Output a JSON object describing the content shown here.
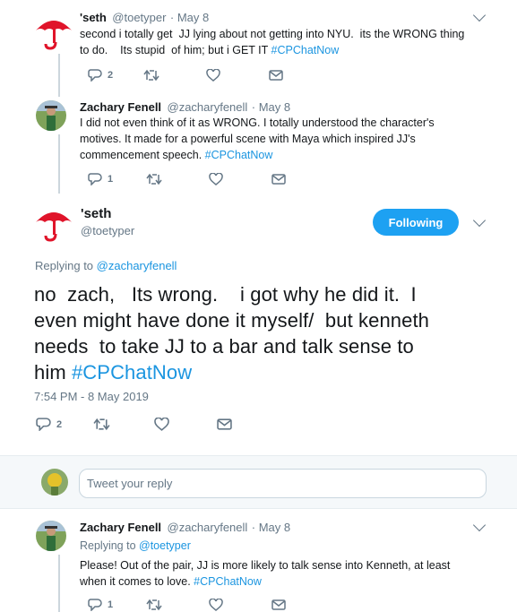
{
  "colors": {
    "accent": "#1da1f2",
    "link": "#1b95e0",
    "umbrella": "#e0142a"
  },
  "tweet1": {
    "name": "'seth",
    "handle": "@toetyper",
    "time": "· May 8",
    "text_a": "second i totally get  JJ lying about not getting into NYU.  its the WRONG thing",
    "text_b": "to do.    Its stupid  of him; but i GET IT ",
    "hashtag": "#CPChatNow",
    "reply_count": "2",
    "avatar_icon": "umbrella-icon"
  },
  "tweet2": {
    "name": "Zachary Fenell",
    "handle": "@zacharyfenell",
    "time": "· May 8",
    "line1": "I did not even think of it as WRONG. I totally understood the character's",
    "line2": "motives. It made for a powerful scene with Maya which inspired JJ's",
    "line3": "commencement speech. ",
    "hashtag": "#CPChatNow",
    "reply_count": "1"
  },
  "main_tweet": {
    "name": "'seth",
    "handle": "@toetyper",
    "follow_label": "Following",
    "replying_prefix": "Replying to ",
    "replying_handle": "@zacharyfenell",
    "line1": "no  zach,   Its wrong.    i got why he did it.  I",
    "line2": "even might have done it myself/  but kenneth",
    "line3": "needs  to take JJ to a bar and talk sense to",
    "line4": "him ",
    "hashtag": "#CPChatNow",
    "timestamp": "7:54 PM - 8 May 2019",
    "reply_count": "2"
  },
  "reply_composer": {
    "placeholder": "Tweet your reply"
  },
  "tweet3": {
    "name": "Zachary Fenell",
    "handle": "@zacharyfenell",
    "time": "· May 8",
    "replying_prefix": "Replying to ",
    "replying_handle": "@toetyper",
    "line1": "Please! Out of the pair, JJ is more likely to talk sense into Kenneth, at least",
    "line2": "when it comes to love. ",
    "hashtag": "#CPChatNow",
    "reply_count": "1"
  }
}
